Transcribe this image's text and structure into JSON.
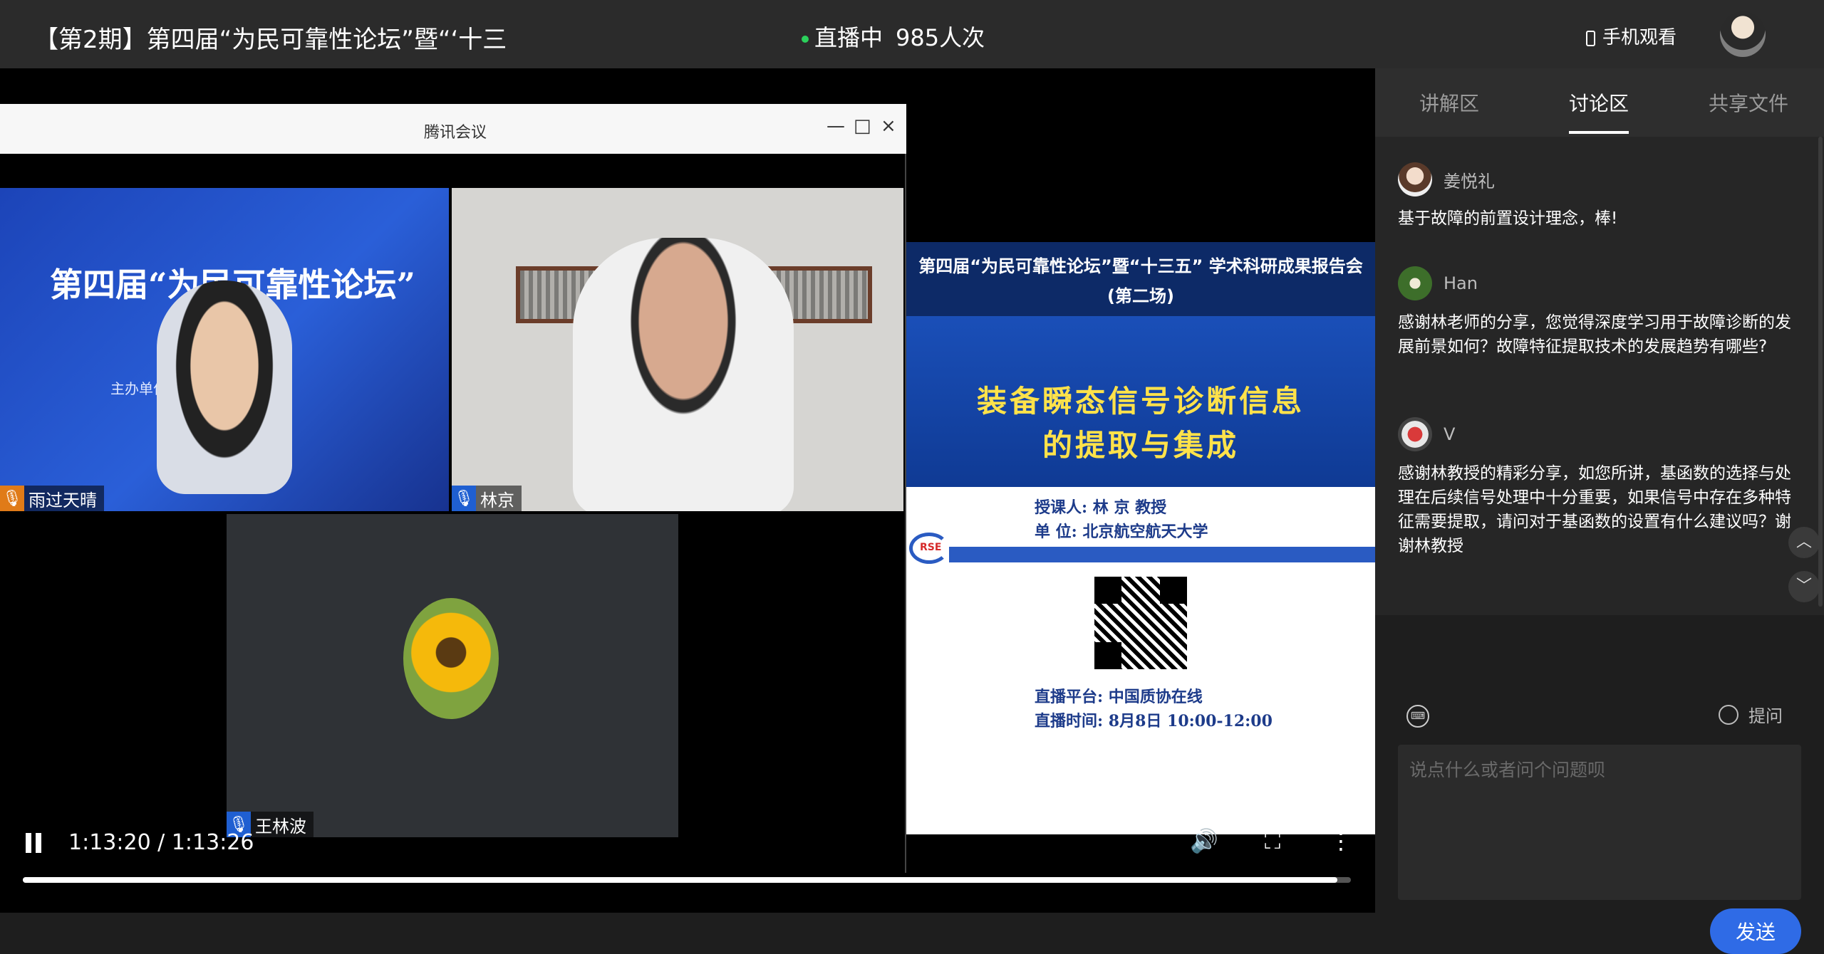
{
  "header": {
    "title": "【第2期】第四届“为民可靠性论坛”暨“‘十三",
    "live_label": "直播中",
    "viewers": "985人次",
    "mobile_label": "手机观看"
  },
  "meeting": {
    "window_title": "腾讯会议",
    "minimize": "—",
    "maximize": "□",
    "close": "×",
    "participants": [
      {
        "name": "雨过天晴"
      },
      {
        "name": "林京"
      },
      {
        "name": "王林波"
      }
    ],
    "tile1_banner": "第四届“为民可靠性论坛”",
    "tile1_sub": "主办单位          工程学院"
  },
  "slide": {
    "header_line1": "第四届“为民可靠性论坛”暨“十三五” 学术科研成果报告会",
    "header_line2": "(第二场)",
    "title_line1": "装备瞬态信号诊断信息",
    "title_line2": "的提取与集成",
    "lecturer": "授课人:  林 京  教授",
    "unit": "单  位: 北京航空航天大学",
    "logo": "RSE",
    "platform": "直播平台: 中国质协在线",
    "time": "直播时间: 8月8日 10:00-12:00"
  },
  "player": {
    "current_time": "1:13:20 / 1:13:26",
    "progress": 0.99,
    "volume_icon": "🔊",
    "fullscreen_icon": "⛶",
    "more_icon": "⋮"
  },
  "sidebar": {
    "tabs": [
      {
        "label": "讲解区"
      },
      {
        "label": "讨论区"
      },
      {
        "label": "共享文件"
      }
    ],
    "messages": [
      {
        "name": "姜悦礼",
        "text": "基于故障的前置设计理念，棒!"
      },
      {
        "name": "Han",
        "text": "感谢林老师的分享，您觉得深度学习用于故障诊断的发展前景如何？故障特征提取技术的发展趋势有哪些?"
      },
      {
        "name": "V",
        "text": "感谢林教授的精彩分享，如您所讲，基函数的选择与处理在后续信号处理中十分重要，如果信号中存在多种特征需要提取，请问对于基函数的设置有什么建议吗？谢谢林教授"
      }
    ],
    "scroll_up": "︿",
    "scroll_down": "﹀",
    "keyboard_icon": "⌨",
    "ask_label": "提问",
    "input_placeholder": "说点什么或者问个问题呗",
    "send_label": "发送"
  }
}
